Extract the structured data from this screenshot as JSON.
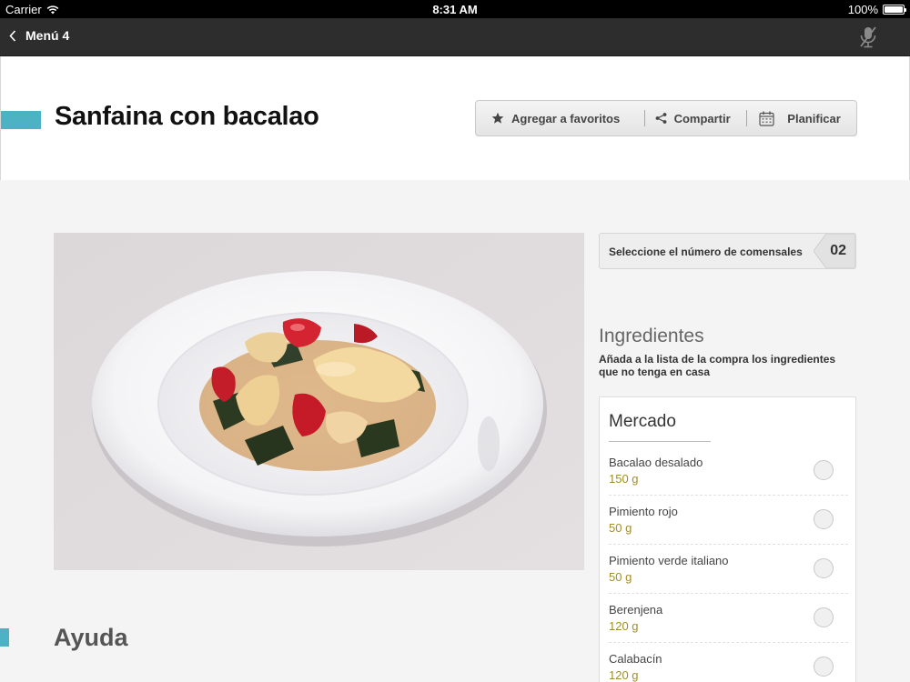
{
  "status_bar": {
    "carrier": "Carrier",
    "time": "8:31 AM",
    "battery": "100%"
  },
  "nav": {
    "back_label": "Menú 4",
    "back_icon": "chevron-left-icon",
    "mic_icon": "microphone-muted-icon"
  },
  "recipe": {
    "title": "Sanfaina con bacalao",
    "accent_color": "#4db3c4",
    "actions": [
      {
        "label": "Agregar a favoritos",
        "icon": "star-icon"
      },
      {
        "label": "Compartir",
        "icon": "share-icon"
      },
      {
        "label": "Planificar",
        "icon": "calendar-icon"
      }
    ]
  },
  "servings": {
    "label": "Seleccione el número de comensales",
    "value": "02"
  },
  "ingredients": {
    "heading": "Ingredientes",
    "note": "Añada a la lista de la compra los ingredientes que no tenga en casa",
    "section_title": "Mercado",
    "qty_color": "#a38d2a",
    "items": [
      {
        "name": "Bacalao desalado",
        "qty": "150 g"
      },
      {
        "name": "Pimiento rojo",
        "qty": "50 g"
      },
      {
        "name": "Pimiento verde italiano",
        "qty": "50 g"
      },
      {
        "name": "Berenjena",
        "qty": "120 g"
      },
      {
        "name": "Calabacín",
        "qty": "120 g"
      }
    ]
  },
  "help": {
    "heading": "Ayuda"
  }
}
